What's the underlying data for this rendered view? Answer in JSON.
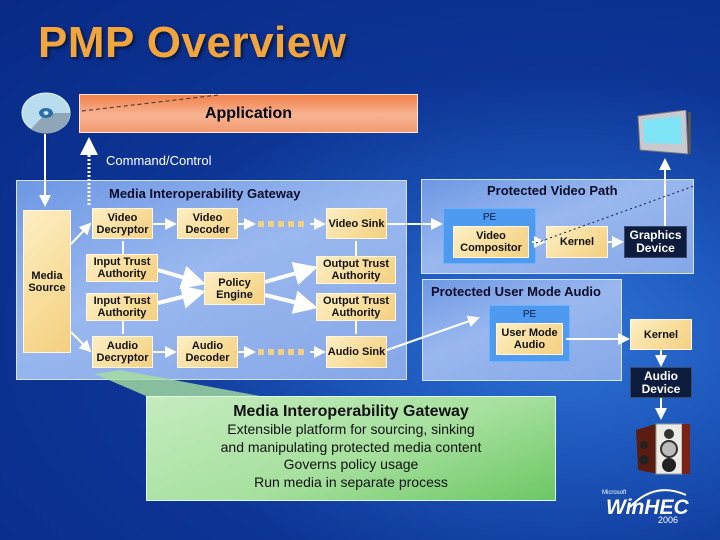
{
  "title": "PMP Overview",
  "application": {
    "label": "Application"
  },
  "command_control": {
    "label": "Command/Control"
  },
  "media_gateway": {
    "title": "Media Interoperability Gateway",
    "media_source": "Media Source",
    "video_decryptor": "Video Decryptor",
    "video_decoder": "Video Decoder",
    "video_sink": "Video Sink",
    "input_trust_authority_1": "Input Trust Authority",
    "input_trust_authority_2": "Input Trust Authority",
    "policy_engine": "Policy Engine",
    "output_trust_authority_1": "Output Trust Authority",
    "output_trust_authority_2": "Output Trust Authority",
    "audio_decryptor": "Audio Decryptor",
    "audio_decoder": "Audio Decoder",
    "audio_sink": "Audio Sink"
  },
  "protected_video_path": {
    "title": "Protected Video Path",
    "pe_label": "PE",
    "video_compositor": "Video Compositor",
    "kernel": "Kernel",
    "graphics_device": "Graphics Device"
  },
  "protected_audio": {
    "title": "Protected User Mode Audio",
    "pe_label": "PE",
    "user_mode_audio": "User Mode Audio",
    "kernel": "Kernel",
    "audio_device": "Audio Device"
  },
  "callout": {
    "title": "Media Interoperability Gateway",
    "lines": [
      "Extensible platform for sourcing, sinking",
      "and manipulating protected media content",
      "Governs policy usage",
      "Run media in separate process"
    ]
  },
  "logo": {
    "brand_small": "Microsoft",
    "brand": "WinHEC",
    "year": "2006"
  },
  "icons": [
    "cd-disc-icon",
    "monitor-icon",
    "speaker-icon"
  ],
  "colors": {
    "title": "#f2a53c",
    "node": "#f8dc98",
    "pe": "#4d9af0",
    "dark_node": "#0d1b3d",
    "callout": "#a6e09e"
  }
}
